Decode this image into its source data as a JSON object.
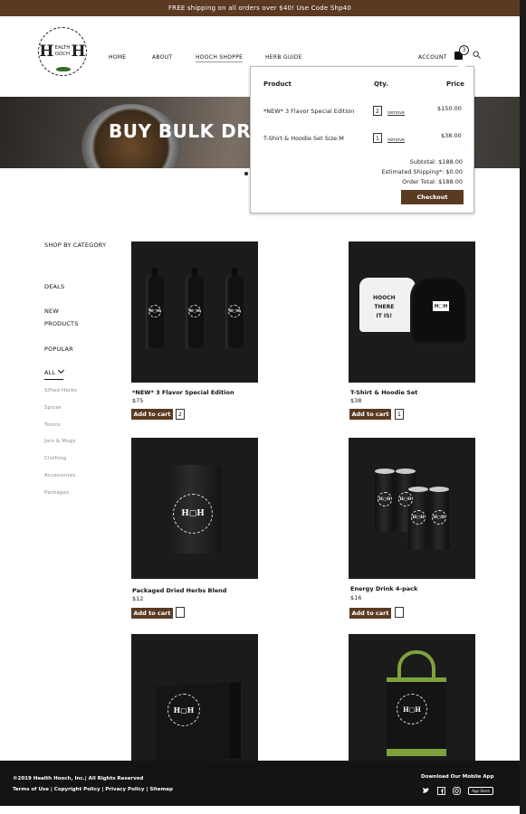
{
  "promo": {
    "text": "FREE shipping on all orders over $40! Use Code Shp40"
  },
  "logo": {
    "big_left": "H",
    "small_top": "EALTH",
    "small_bottom": "OOCH",
    "big_right": "H"
  },
  "nav": {
    "items": [
      {
        "label": "HOME"
      },
      {
        "label": "ABOUT"
      },
      {
        "label": "HOOCH SHOPPE"
      },
      {
        "label": "HERB GUIDE"
      }
    ],
    "account": "ACCOUNT",
    "cart_count": "3",
    "cart_icon": "shopping-bag-icon",
    "search_icon": "search-icon"
  },
  "hero": {
    "title": "BUY BULK DRIED"
  },
  "cart": {
    "headers": {
      "product": "Product",
      "qty": "Qty.",
      "price": "Price"
    },
    "items": [
      {
        "name": "*NEW* 3 Flavor Special Edition",
        "qty": "2",
        "remove": "remove",
        "price": "$150.00"
      },
      {
        "name": "T-Shirt & Hoodie Set  Size:M",
        "qty": "1",
        "remove": "remove",
        "price": "$38.00"
      }
    ],
    "subtotal": "Subtotal: $188.00",
    "shipping": "Estimated Shipping*: $0.00",
    "total": "Order Total: $188.00",
    "checkout": "Checkout"
  },
  "sidebar": {
    "heading": "SHOP BY CATEGORY",
    "main": [
      "DEALS",
      "NEW",
      "PRODUCTS",
      "POPULAR",
      "ALL"
    ],
    "sub": [
      "Sifted Herbs",
      "Spices",
      "Tonics",
      "Jars & Mugs",
      "Clothing",
      "Accessories",
      "Packages"
    ]
  },
  "products": [
    {
      "name": "*NEW* 3 Flavor Special Edition",
      "price": "$75",
      "qty": "2"
    },
    {
      "name": "T-Shirt & Hoodie Set",
      "price": "$38",
      "qty": "1"
    },
    {
      "name": "Packaged Dried Herbs Blend",
      "price": "$12",
      "qty": ""
    },
    {
      "name": "Energy Drink  4-pack",
      "price": "$16",
      "qty": ""
    }
  ],
  "add_to_cart": "Add to cart",
  "tee_text": [
    "HOOCH",
    "THERE",
    "IT IS!"
  ],
  "hoodie_logo": "H▢H",
  "footer": {
    "copyright": "©2019 Health Hooch, Inc.|  All Rights Reserved",
    "links": "Terms of Use | Copyright Policy | Privacy Policy | Sitemap",
    "app": "Download Our Mobile App",
    "appstore": "App Store"
  }
}
